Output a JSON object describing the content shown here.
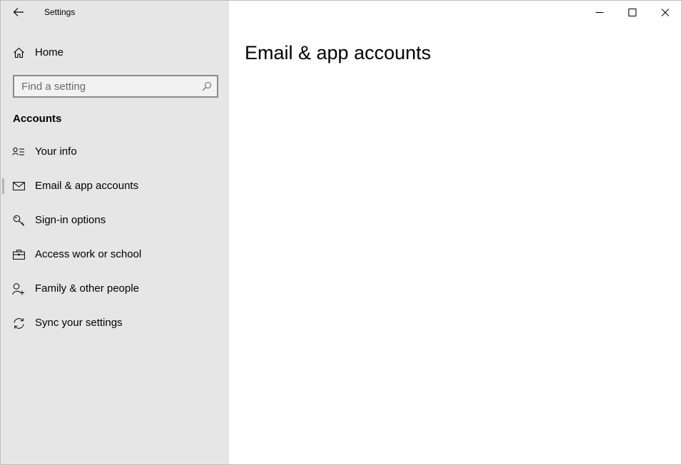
{
  "window": {
    "title": "Settings",
    "controls": [
      "minimize",
      "maximize",
      "close"
    ]
  },
  "sidebar": {
    "home_label": "Home",
    "search": {
      "placeholder": "Find a setting",
      "value": ""
    },
    "section_heading": "Accounts",
    "items": [
      {
        "label": "Your info",
        "icon": "contact-card-icon",
        "selected": false
      },
      {
        "label": "Email & app accounts",
        "icon": "mail-icon",
        "selected": true
      },
      {
        "label": "Sign-in options",
        "icon": "key-icon",
        "selected": false
      },
      {
        "label": "Access work or school",
        "icon": "briefcase-icon",
        "selected": false
      },
      {
        "label": "Family & other people",
        "icon": "add-person-icon",
        "selected": false
      },
      {
        "label": "Sync your settings",
        "icon": "sync-icon",
        "selected": false
      }
    ]
  },
  "main": {
    "page_title": "Email & app accounts"
  },
  "colors": {
    "sidebar_bg": "#e6e6e6",
    "content_bg": "#ffffff",
    "selection_indicator": "#b3b3b3",
    "search_border": "#8a8a8a"
  }
}
